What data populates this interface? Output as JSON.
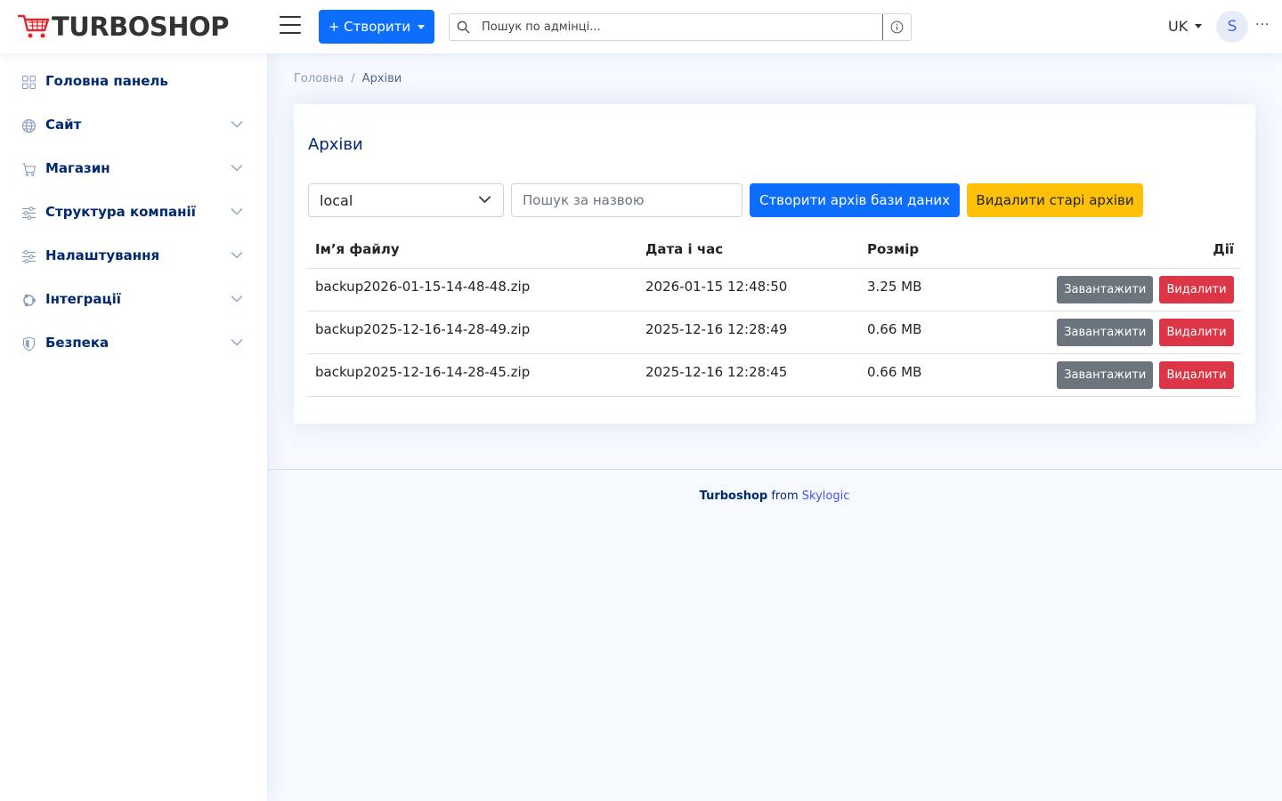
{
  "header": {
    "logo_text": "TURBOSHOP",
    "create_button": "+ Створити",
    "search_placeholder": "Пошук по адмінці...",
    "language": "UK",
    "avatar_initial": "S",
    "more": "···"
  },
  "sidebar": {
    "items": [
      {
        "label": "Головна панель",
        "icon": "grid-icon",
        "expandable": false
      },
      {
        "label": "Сайт",
        "icon": "globe-icon",
        "expandable": true
      },
      {
        "label": "Магазин",
        "icon": "cart-icon",
        "expandable": true
      },
      {
        "label": "Структура компанії",
        "icon": "sliders-icon",
        "expandable": true
      },
      {
        "label": "Налаштування",
        "icon": "sliders-icon",
        "expandable": true
      },
      {
        "label": "Інтеграції",
        "icon": "ubuntu-icon",
        "expandable": true
      },
      {
        "label": "Безпека",
        "icon": "shield-icon",
        "expandable": true
      }
    ]
  },
  "breadcrumb": {
    "home": "Головна",
    "separator": "/",
    "current": "Архіви"
  },
  "card": {
    "title": "Архіви",
    "storage_select_value": "local",
    "name_search_placeholder": "Пошук за назвою",
    "create_db_archive_button": "Створити архів бази даних",
    "delete_old_button": "Видалити старі архіви"
  },
  "table": {
    "columns": [
      "Ім’я файлу",
      "Дата і час",
      "Розмір",
      "Дії"
    ],
    "rows": [
      {
        "file": "backup2026-01-15-14-48-48.zip",
        "datetime": "2026-01-15 12:48:50",
        "size": "3.25 MB"
      },
      {
        "file": "backup2025-12-16-14-28-49.zip",
        "datetime": "2025-12-16 12:28:49",
        "size": "0.66 MB"
      },
      {
        "file": "backup2025-12-16-14-28-45.zip",
        "datetime": "2025-12-16 12:28:45",
        "size": "0.66 MB"
      }
    ],
    "download_label": "Завантажити",
    "delete_label": "Видалити"
  },
  "footer": {
    "brand": "Turboshop",
    "from": "from",
    "company": "Skylogic"
  },
  "colors": {
    "primary": "#0d6efd",
    "warning": "#ffc107",
    "secondary": "#6c757d",
    "danger": "#dc3545",
    "nav_text": "#012970",
    "logo_red": "#e0262f"
  }
}
